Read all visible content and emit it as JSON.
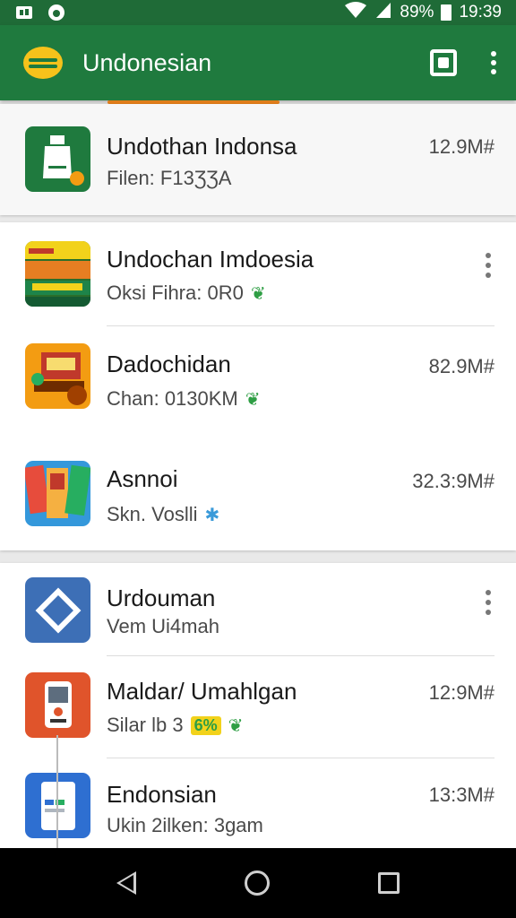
{
  "status_bar": {
    "battery_text": "89%",
    "time": "19:39",
    "icons": [
      "screenshot-icon",
      "notification-icon",
      "wifi-icon",
      "signal-icon",
      "battery-icon"
    ]
  },
  "app_bar": {
    "title": "Undonesian",
    "icons": [
      "logo-icon",
      "square-action-icon",
      "more-vert-icon"
    ],
    "colors": {
      "bar": "#1f7a3e",
      "accent": "#f6c21b"
    }
  },
  "featured": {
    "title": "Undothan Indonsa",
    "subtitle": "Filen: F13ƷƷA",
    "size": "12.9M#"
  },
  "list_section_1": [
    {
      "title": "Undochan Imdoesia",
      "subtitle": "Oksi Fihra: 0R0",
      "size": "",
      "has_menu": true,
      "icon": "poster-icon"
    },
    {
      "title": "Dadochidan",
      "subtitle": "Chan: 0130KM",
      "size": "82.9M#",
      "has_menu": false,
      "icon": "food-icon"
    },
    {
      "title": "Asnnoi",
      "subtitle": "Skn. Voslli",
      "size": "32.3:9M#",
      "has_menu": false,
      "icon": "books-icon"
    }
  ],
  "list_section_2": [
    {
      "title": "Urdouman",
      "subtitle": "Vem Ui4mah",
      "size": "",
      "has_menu": true,
      "icon": "diamond-icon"
    },
    {
      "title": "Maldar/ Umahlgan",
      "subtitle": "Silar lb 3",
      "badge": "6%",
      "size": "12:9M#",
      "has_menu": false,
      "icon": "device-icon"
    },
    {
      "title": "Endonsian",
      "subtitle": "Ukin 2ilken: 3gam",
      "size": "13:3M#",
      "has_menu": false,
      "icon": "tablet-icon"
    }
  ],
  "nav_bar": {
    "icons": [
      "back-icon",
      "home-icon",
      "recents-icon"
    ]
  }
}
